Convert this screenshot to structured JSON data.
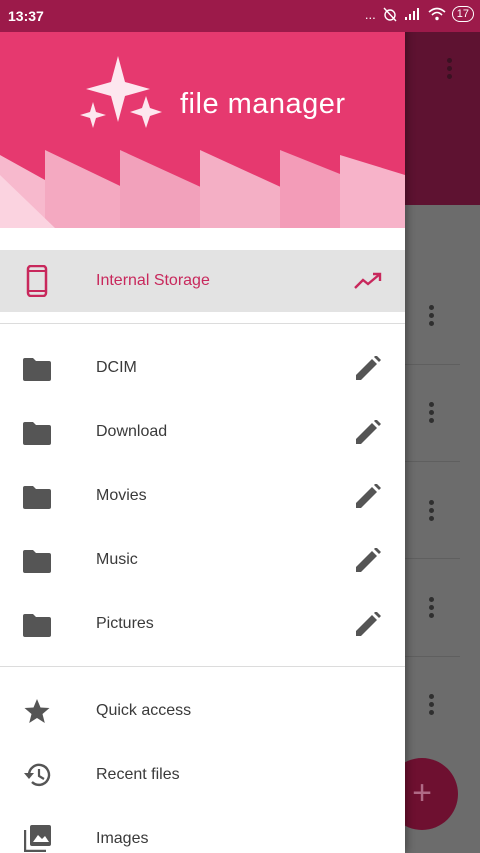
{
  "status_bar": {
    "time": "13:37",
    "icons_text": "...",
    "battery": "17"
  },
  "app": {
    "title": "file manager"
  },
  "storage": {
    "label": "Internal Storage",
    "icon": "phone-icon",
    "trend_icon": "trend-icon"
  },
  "folders": [
    {
      "label": "DCIM"
    },
    {
      "label": "Download"
    },
    {
      "label": "Movies"
    },
    {
      "label": "Music"
    },
    {
      "label": "Pictures"
    }
  ],
  "sections": [
    {
      "label": "Quick access",
      "icon": "star-icon"
    },
    {
      "label": "Recent files",
      "icon": "history-icon"
    },
    {
      "label": "Images",
      "icon": "images-icon"
    }
  ],
  "background": {
    "fab_symbol": "+"
  },
  "colors": {
    "accent": "#e6396f",
    "status": "#9c1a4a",
    "selected_bg": "#e3e3e3",
    "accent_text": "#c8285c",
    "icon": "#555555"
  }
}
